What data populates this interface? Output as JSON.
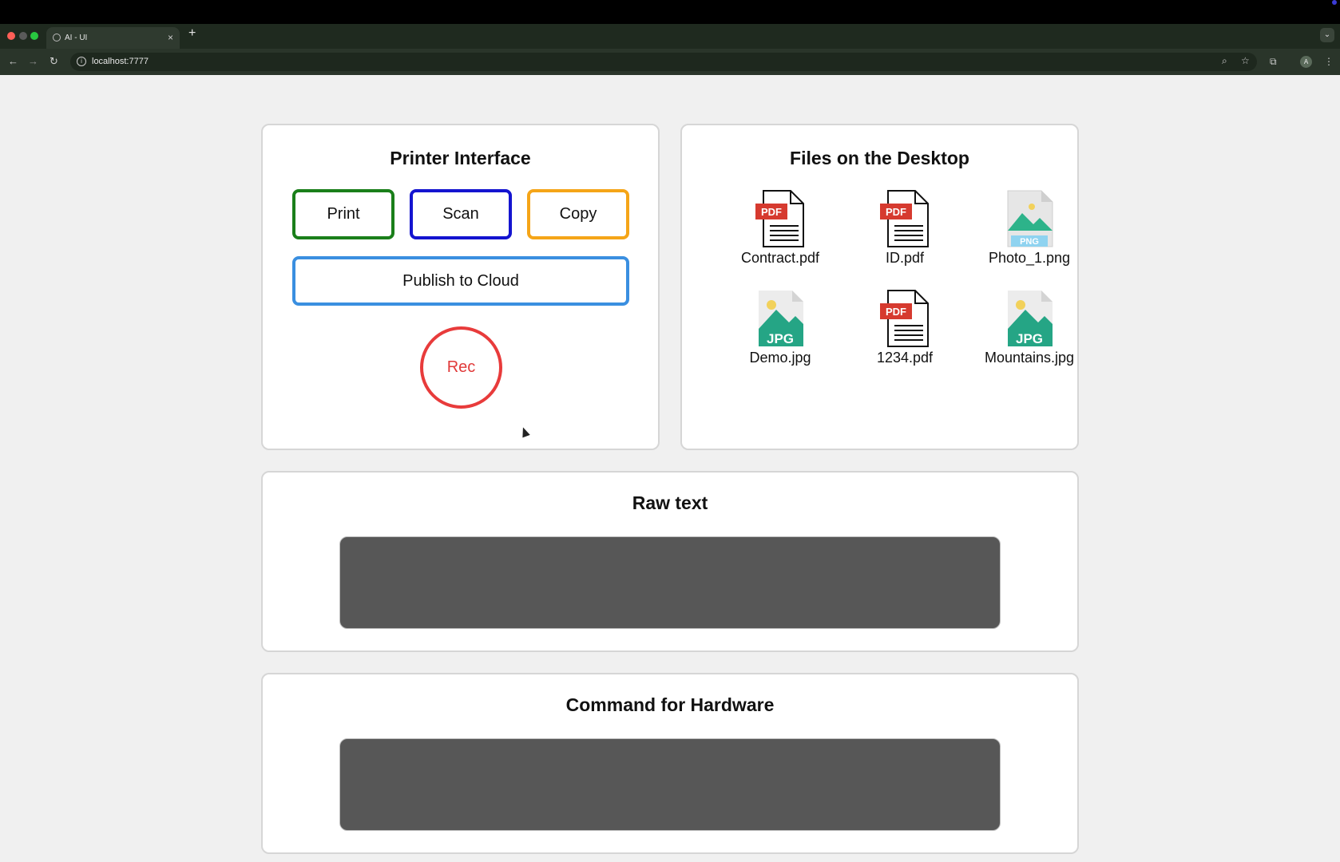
{
  "browser": {
    "tab_title": "AI - UI",
    "tab_close": "×",
    "new_tab": "+",
    "tab_menu": "⌄",
    "url": "localhost:7777",
    "back": "←",
    "forward": "→",
    "reload": "↻",
    "zoom_icon": "⌕",
    "star_icon": "☆",
    "extensions_icon": "⧉",
    "profile_initial": "A",
    "menu_icon": "⋮"
  },
  "printer": {
    "title": "Printer Interface",
    "print_label": "Print",
    "scan_label": "Scan",
    "copy_label": "Copy",
    "cloud_label": "Publish to Cloud",
    "rec_label": "Rec",
    "colors": {
      "print": "#1a7f1a",
      "scan": "#1414d0",
      "copy": "#f5a518",
      "cloud": "#3a8fe0",
      "rec": "#e83b3b"
    }
  },
  "files": {
    "title": "Files on the Desktop",
    "items": [
      {
        "name": "Contract.pdf",
        "type": "pdf"
      },
      {
        "name": "ID.pdf",
        "type": "pdf"
      },
      {
        "name": "Photo_1.png",
        "type": "png"
      },
      {
        "name": "Demo.jpg",
        "type": "jpg"
      },
      {
        "name": "1234.pdf",
        "type": "pdf"
      },
      {
        "name": "Mountains.jpg",
        "type": "jpg"
      }
    ],
    "badge_pdf": "PDF",
    "badge_jpg": "JPG",
    "badge_png": "PNG"
  },
  "raw_text": {
    "title": "Raw text",
    "value": ""
  },
  "command": {
    "title": "Command for Hardware",
    "value": ""
  }
}
